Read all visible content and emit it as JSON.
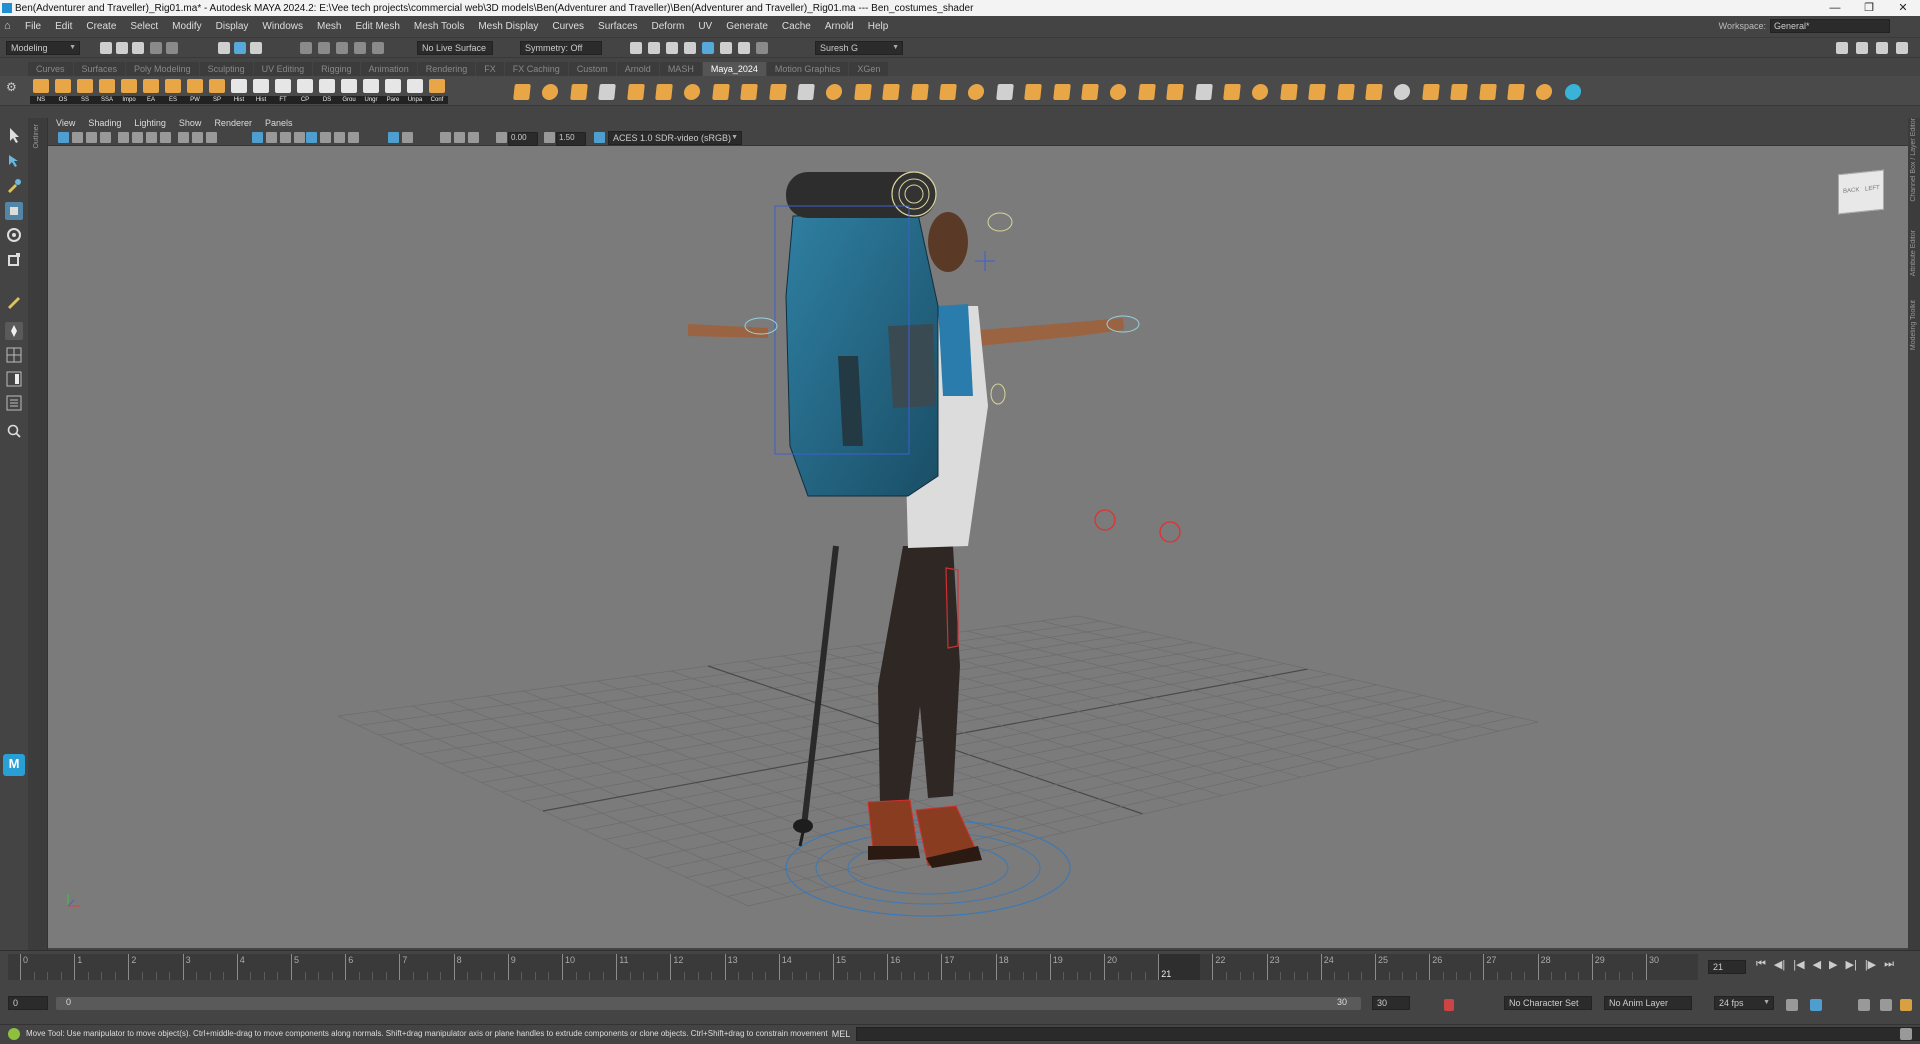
{
  "window": {
    "title": "Ben(Adventurer and Traveller)_Rig01.ma* - Autodesk MAYA 2024.2: E:\\Vee tech projects\\commercial web\\3D models\\Ben(Adventurer and Traveller)\\Ben(Adventurer and Traveller)_Rig01.ma  ---  Ben_costumes_shader"
  },
  "menubar": {
    "items": [
      "File",
      "Edit",
      "Create",
      "Select",
      "Modify",
      "Display",
      "Windows",
      "Mesh",
      "Edit Mesh",
      "Mesh Tools",
      "Mesh Display",
      "Curves",
      "Surfaces",
      "Deform",
      "UV",
      "Generate",
      "Cache",
      "Arnold",
      "Help"
    ]
  },
  "workspace": {
    "label": "Workspace:",
    "value": "General*"
  },
  "statusline": {
    "mode": "Modeling",
    "live_surface": "No Live Surface",
    "symmetry": "Symmetry: Off",
    "user": "Suresh G"
  },
  "shelf": {
    "tabs": [
      "Curves",
      "Surfaces",
      "Poly Modeling",
      "Sculpting",
      "UV Editing",
      "Rigging",
      "Animation",
      "Rendering",
      "FX",
      "FX Caching",
      "Custom",
      "Arnold",
      "MASH",
      "Maya_2024",
      "Motion Graphics",
      "XGen"
    ],
    "active_tab": "Maya_2024",
    "buttons": [
      "NS",
      "OS",
      "SS",
      "SSA",
      "Impo",
      "EA",
      "ES",
      "PW",
      "SP",
      "Hist",
      "Hist",
      "FT",
      "CP",
      "DS",
      "Grou",
      "Ungr",
      "Pare",
      "Unpa",
      "Conf"
    ]
  },
  "panel": {
    "menus": [
      "View",
      "Shading",
      "Lighting",
      "Show",
      "Renderer",
      "Panels"
    ],
    "exposure": "0.00",
    "gamma": "1.50",
    "colorspace": "ACES 1.0 SDR-video (sRGB)"
  },
  "side_labels": {
    "outliner": "Outliner",
    "channel_box": "Channel Box / Layer Editor",
    "attribute_editor": "Attribute Editor",
    "modeling_toolkit": "Modeling Toolkit"
  },
  "viewcube": {
    "back": "BACK",
    "left": "LEFT"
  },
  "timeline": {
    "ticks": [
      "0",
      "1",
      "2",
      "3",
      "4",
      "5",
      "6",
      "7",
      "8",
      "9",
      "10",
      "11",
      "12",
      "13",
      "14",
      "15",
      "16",
      "17",
      "18",
      "19",
      "20",
      "21",
      "22",
      "23",
      "24",
      "25",
      "26",
      "27",
      "28",
      "29",
      "30"
    ],
    "current_frame": "21",
    "current_frame_field": "21"
  },
  "range": {
    "start": "0",
    "inner_start": "0",
    "inner_end": "30",
    "end": "30",
    "character_set": "No Character Set",
    "anim_layer": "No Anim Layer",
    "fps": "24 fps"
  },
  "helpline": {
    "text": "Move Tool: Use manipulator to move object(s). Ctrl+middle-drag to move components along normals. Shift+drag manipulator axis or plane handles to extrude components or clone objects. Ctrl+Shift+drag to constrain movement to a co"
  },
  "cmdline": {
    "language": "MEL"
  }
}
